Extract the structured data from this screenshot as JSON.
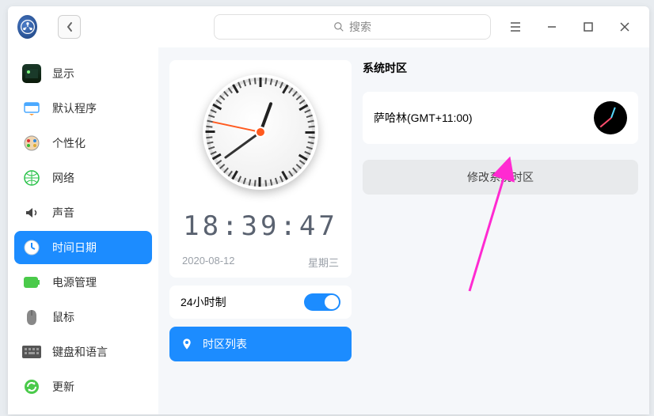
{
  "titlebar": {
    "search_placeholder": "搜索"
  },
  "sidebar": {
    "items": [
      {
        "label": "显示"
      },
      {
        "label": "默认程序"
      },
      {
        "label": "个性化"
      },
      {
        "label": "网络"
      },
      {
        "label": "声音"
      },
      {
        "label": "时间日期"
      },
      {
        "label": "电源管理"
      },
      {
        "label": "鼠标"
      },
      {
        "label": "键盘和语言"
      },
      {
        "label": "更新"
      }
    ],
    "active_index": 5
  },
  "clock": {
    "digital_time": "18:39:47",
    "date": "2020-08-12",
    "weekday": "星期三",
    "hour24_label": "24小时制",
    "hour24_on": true,
    "timezone_list_label": "时区列表"
  },
  "system_tz": {
    "section_title": "系统时区",
    "current": "萨哈林(GMT+11:00)",
    "change_label": "修改系统时区"
  },
  "colors": {
    "accent": "#1c8cff",
    "annotation": "#ff2ad1"
  }
}
